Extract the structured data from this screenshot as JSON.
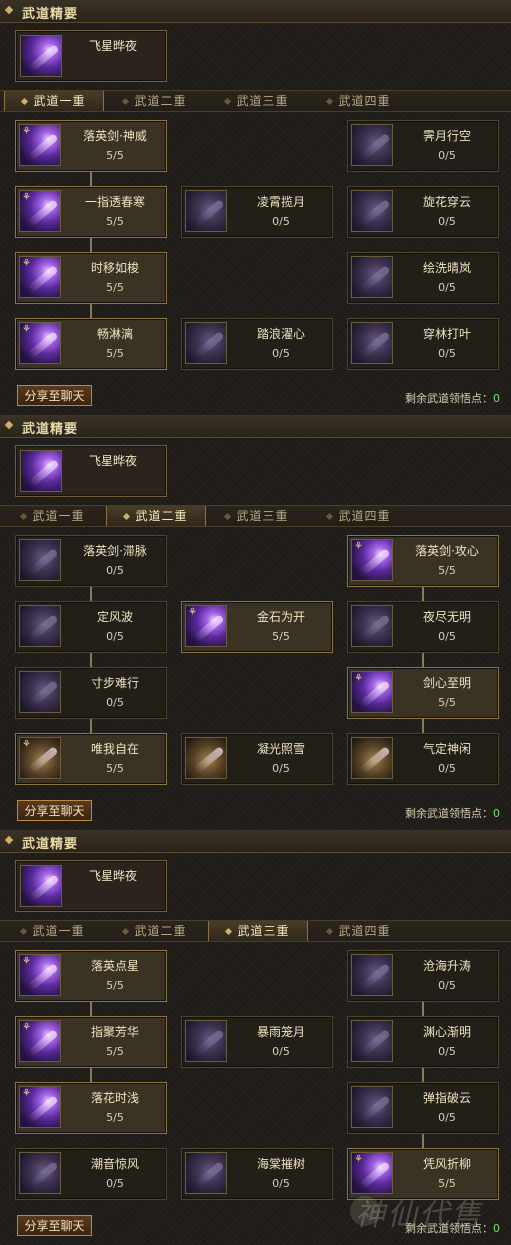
{
  "panels": [
    {
      "section_title": "武道精要",
      "essence": "飞星晔夜",
      "tabs": [
        "武道一重",
        "武道二重",
        "武道三重",
        "武道四重"
      ],
      "active_tab": 0,
      "share_label": "分享至聊天",
      "remain_label": "剩余武道领悟点：",
      "remain_value": "0",
      "nodes": [
        {
          "col": 0,
          "row": 0,
          "name": "落英剑·神威",
          "level": "5/5",
          "lit": true,
          "icon": "active"
        },
        {
          "col": 2,
          "row": 0,
          "name": "霁月行空",
          "level": "0/5",
          "lit": false,
          "icon": "dim"
        },
        {
          "col": 0,
          "row": 1,
          "name": "一指透春寒",
          "level": "5/5",
          "lit": true,
          "icon": "active"
        },
        {
          "col": 1,
          "row": 1,
          "name": "凌霄揽月",
          "level": "0/5",
          "lit": false,
          "icon": "dim"
        },
        {
          "col": 2,
          "row": 1,
          "name": "旋花穿云",
          "level": "0/5",
          "lit": false,
          "icon": "dim"
        },
        {
          "col": 0,
          "row": 2,
          "name": "时移如梭",
          "level": "5/5",
          "lit": true,
          "icon": "active"
        },
        {
          "col": 2,
          "row": 2,
          "name": "绘洗晴岚",
          "level": "0/5",
          "lit": false,
          "icon": "dim"
        },
        {
          "col": 0,
          "row": 3,
          "name": "畅淋漓",
          "level": "5/5",
          "lit": true,
          "icon": "active"
        },
        {
          "col": 1,
          "row": 3,
          "name": "踏浪濯心",
          "level": "0/5",
          "lit": false,
          "icon": "dim"
        },
        {
          "col": 2,
          "row": 3,
          "name": "穿林打叶",
          "level": "0/5",
          "lit": false,
          "icon": "dim"
        }
      ],
      "connectors": [
        {
          "col": 0,
          "from": 0,
          "to": 3
        }
      ]
    },
    {
      "section_title": "武道精要",
      "essence": "飞星晔夜",
      "tabs": [
        "武道一重",
        "武道二重",
        "武道三重",
        "武道四重"
      ],
      "active_tab": 1,
      "share_label": "分享至聊天",
      "remain_label": "剩余武道领悟点：",
      "remain_value": "0",
      "nodes": [
        {
          "col": 0,
          "row": 0,
          "name": "落英剑·滞脉",
          "level": "0/5",
          "lit": false,
          "icon": "dim"
        },
        {
          "col": 2,
          "row": 0,
          "name": "落英剑·攻心",
          "level": "5/5",
          "lit": true,
          "icon": "active"
        },
        {
          "col": 0,
          "row": 1,
          "name": "定风波",
          "level": "0/5",
          "lit": false,
          "icon": "dim"
        },
        {
          "col": 1,
          "row": 1,
          "name": "金石为开",
          "level": "5/5",
          "lit": true,
          "icon": "active"
        },
        {
          "col": 2,
          "row": 1,
          "name": "夜尽无明",
          "level": "0/5",
          "lit": false,
          "icon": "dim"
        },
        {
          "col": 0,
          "row": 2,
          "name": "寸步难行",
          "level": "0/5",
          "lit": false,
          "icon": "dim"
        },
        {
          "col": 2,
          "row": 2,
          "name": "剑心至明",
          "level": "5/5",
          "lit": true,
          "icon": "active"
        },
        {
          "col": 0,
          "row": 3,
          "name": "唯我自在",
          "level": "5/5",
          "lit": true,
          "icon": "gold"
        },
        {
          "col": 1,
          "row": 3,
          "name": "凝光照雪",
          "level": "0/5",
          "lit": false,
          "icon": "gold"
        },
        {
          "col": 2,
          "row": 3,
          "name": "气定神闲",
          "level": "0/5",
          "lit": false,
          "icon": "gold"
        }
      ],
      "connectors": [
        {
          "col": 0,
          "from": 0,
          "to": 3
        },
        {
          "col": 2,
          "from": 0,
          "to": 3
        }
      ]
    },
    {
      "section_title": "武道精要",
      "essence": "飞星晔夜",
      "tabs": [
        "武道一重",
        "武道二重",
        "武道三重",
        "武道四重"
      ],
      "active_tab": 2,
      "share_label": "分享至聊天",
      "remain_label": "剩余武道领悟点：",
      "remain_value": "0",
      "nodes": [
        {
          "col": 0,
          "row": 0,
          "name": "落英点星",
          "level": "5/5",
          "lit": true,
          "icon": "active"
        },
        {
          "col": 2,
          "row": 0,
          "name": "沧海升涛",
          "level": "0/5",
          "lit": false,
          "icon": "dim"
        },
        {
          "col": 0,
          "row": 1,
          "name": "指聚芳华",
          "level": "5/5",
          "lit": true,
          "icon": "active"
        },
        {
          "col": 1,
          "row": 1,
          "name": "暴雨笼月",
          "level": "0/5",
          "lit": false,
          "icon": "dim"
        },
        {
          "col": 2,
          "row": 1,
          "name": "渊心渐明",
          "level": "0/5",
          "lit": false,
          "icon": "dim"
        },
        {
          "col": 0,
          "row": 2,
          "name": "落花时浅",
          "level": "5/5",
          "lit": true,
          "icon": "active"
        },
        {
          "col": 2,
          "row": 2,
          "name": "弹指破云",
          "level": "0/5",
          "lit": false,
          "icon": "dim"
        },
        {
          "col": 0,
          "row": 3,
          "name": "潮音惊风",
          "level": "0/5",
          "lit": false,
          "icon": "dim"
        },
        {
          "col": 1,
          "row": 3,
          "name": "海棠摧树",
          "level": "0/5",
          "lit": false,
          "icon": "dim"
        },
        {
          "col": 2,
          "row": 3,
          "name": "凭风折柳",
          "level": "5/5",
          "lit": true,
          "icon": "active"
        }
      ],
      "connectors": [
        {
          "col": 0,
          "from": 0,
          "to": 2
        },
        {
          "col": 2,
          "from": 0,
          "to": 3
        }
      ]
    }
  ],
  "watermark": "神仙代售"
}
